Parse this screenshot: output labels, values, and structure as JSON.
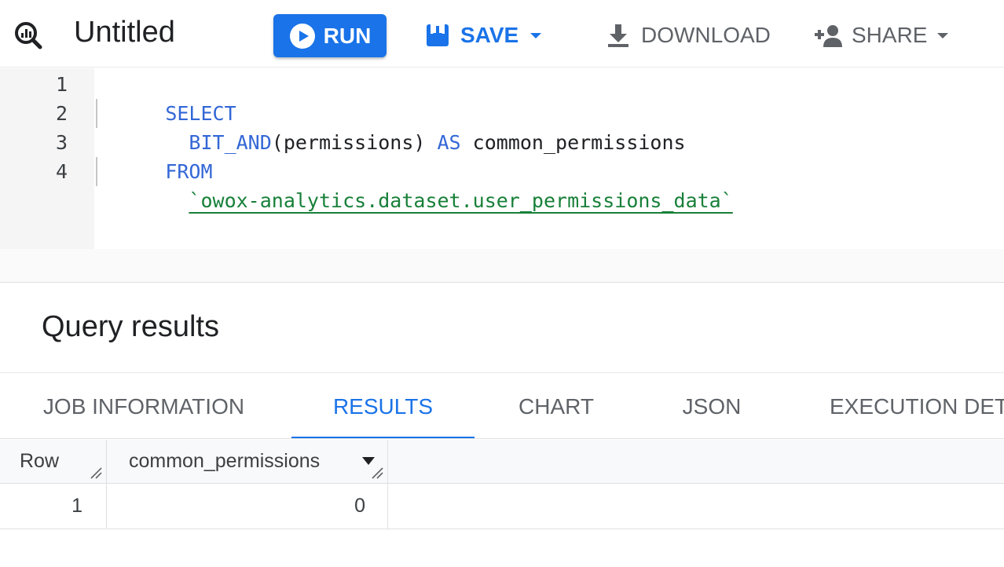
{
  "toolbar": {
    "query_icon": "query-search-icon",
    "title": "Untitled",
    "run_label": "RUN",
    "save_label": "SAVE",
    "download_label": "DOWNLOAD",
    "share_label": "SHARE"
  },
  "editor": {
    "lines": [
      {
        "num": "1",
        "tokens": [
          {
            "t": "SELECT",
            "k": "kw"
          }
        ]
      },
      {
        "num": "2",
        "tokens": [
          {
            "t": "  BIT_AND",
            "k": "kw"
          },
          {
            "t": "(permissions) ",
            "k": "plain"
          },
          {
            "t": "AS",
            "k": "kw"
          },
          {
            "t": " common_permissions",
            "k": "plain"
          }
        ]
      },
      {
        "num": "3",
        "tokens": [
          {
            "t": "FROM",
            "k": "kw"
          }
        ]
      },
      {
        "num": "4",
        "tokens": [
          {
            "t": "  ",
            "k": "plain"
          },
          {
            "t": "`owox-analytics.dataset.user_permissions_data`",
            "k": "str"
          }
        ]
      }
    ]
  },
  "results": {
    "title": "Query results",
    "tabs": [
      {
        "label": "JOB INFORMATION",
        "active": false
      },
      {
        "label": "RESULTS",
        "active": true
      },
      {
        "label": "CHART",
        "active": false
      },
      {
        "label": "JSON",
        "active": false
      },
      {
        "label": "EXECUTION DETAILS",
        "active": false
      }
    ],
    "columns": {
      "row": "Row",
      "col1": "common_permissions"
    },
    "rows": [
      {
        "row": "1",
        "common_permissions": "0"
      }
    ]
  },
  "colors": {
    "accent": "#1a73e8",
    "keyword": "#3367d6",
    "string": "#188038"
  }
}
